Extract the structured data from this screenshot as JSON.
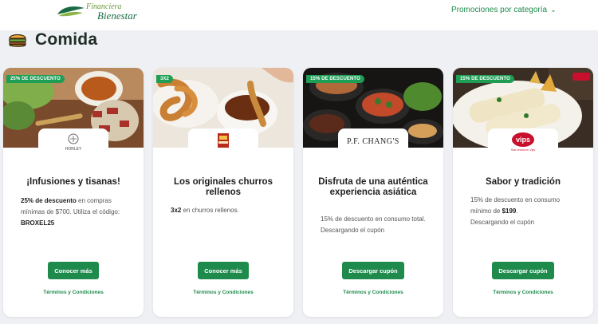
{
  "header": {
    "logo_line1": "Financiera",
    "logo_line2": "Bienestar",
    "promo_nav_label": "Promociones por categoría"
  },
  "section": {
    "title": "Comida"
  },
  "cards": [
    {
      "badge": "25% DE DESCUENTO",
      "brand": "HORLEY",
      "title": "¡Infusiones y tisanas!",
      "desc_bold1": "25% de descuento",
      "desc_text1": " en compras mínimas de $700. Utiliza el código:",
      "desc_bold2": "BROXEL25",
      "button": "Conocer más",
      "terms": "Términos y Condiciones"
    },
    {
      "badge": "3X2",
      "brand": "CHURRERÍA",
      "title": "Los originales churros rellenos",
      "desc_bold1": "3x2",
      "desc_text1": " en churros rellenos.",
      "button": "Conocer más",
      "terms": "Términos y Condiciones"
    },
    {
      "badge": "15% DE DESCUENTO",
      "brand": "P.F. CHANG'S",
      "title": "Disfruta de una auténtica experiencia asiática",
      "desc_line1": "15% de descuento en consumo total.",
      "desc_line2": "Descargando el cupón",
      "button": "Descargar cupón",
      "terms": "Términos y Condiciones"
    },
    {
      "badge": "15% DE DESCUENTO",
      "brand": "vips",
      "brand_sub": "Nos vemos en Vips",
      "title": "Sabor y tradición",
      "desc_text1": "15% de descuento en consumo mínimo de ",
      "desc_bold1": "$199",
      "desc_text2": ".",
      "desc_line2": "Descargando el cupón",
      "button": "Descargar cupón",
      "terms": "Términos y Condiciones"
    }
  ]
}
